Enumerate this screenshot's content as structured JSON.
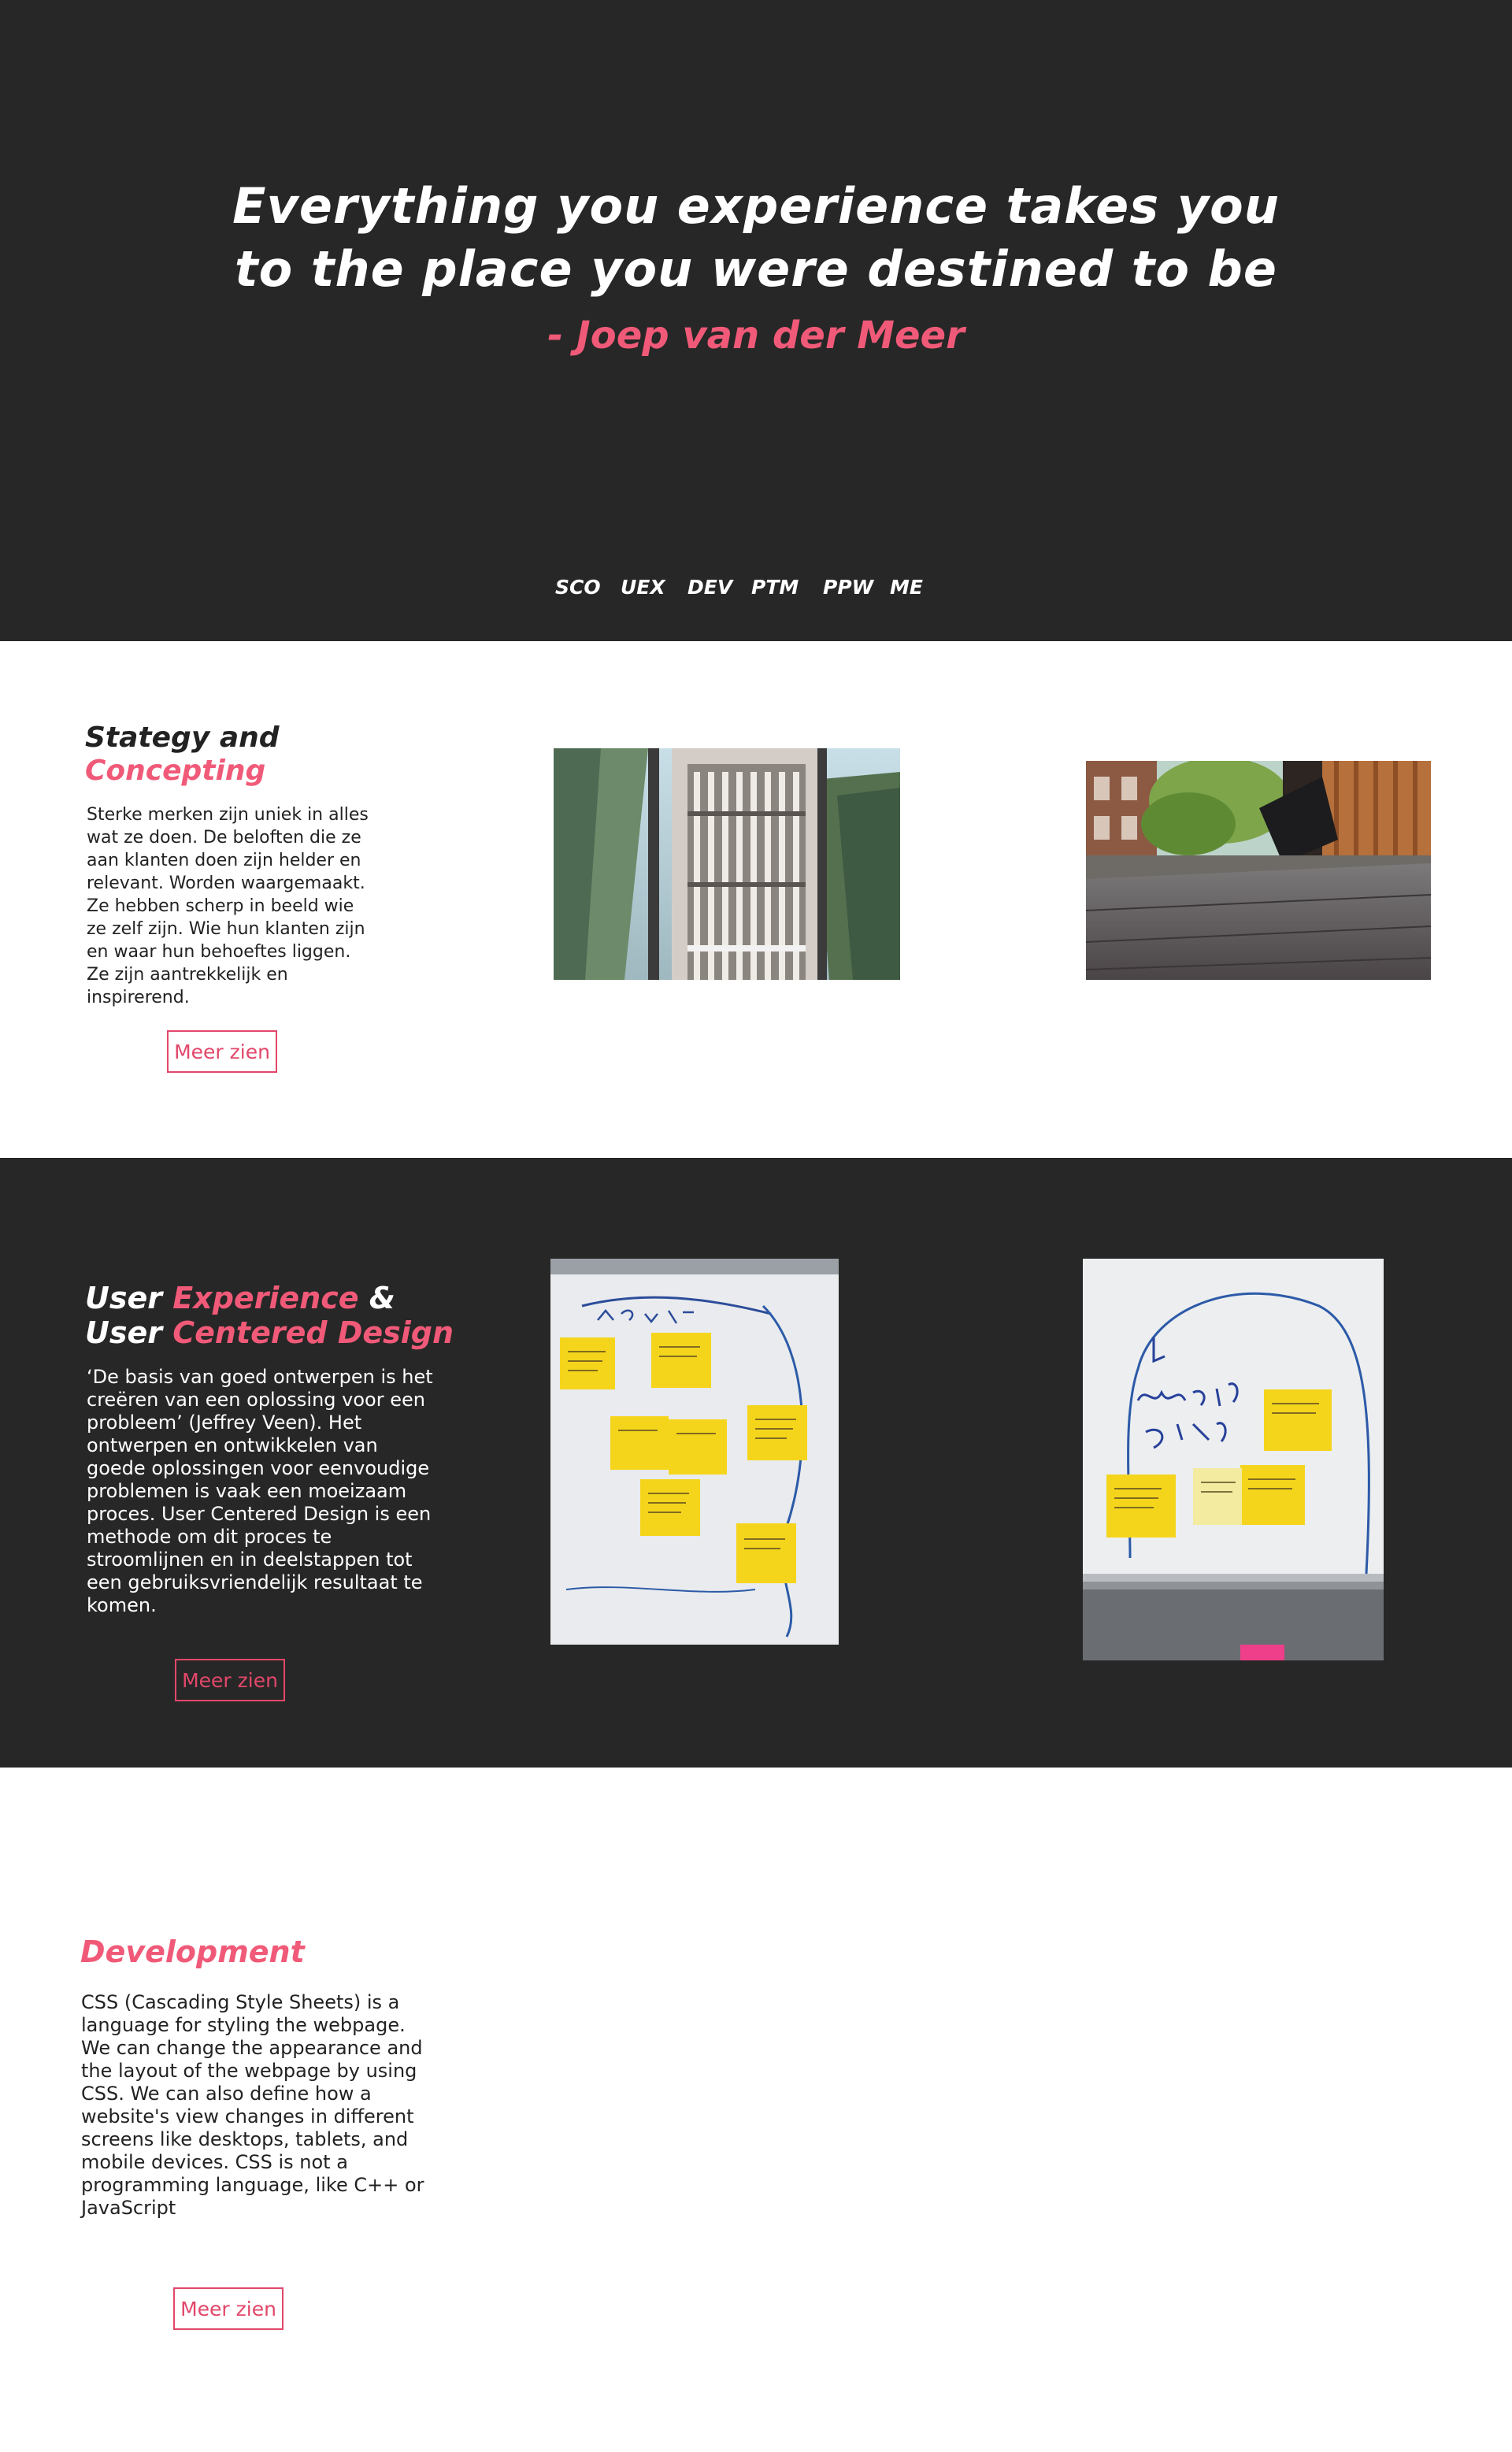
{
  "hero": {
    "quote_line1": "Everything you experience takes you",
    "quote_line2": "to the place you were destined to be",
    "author": "- Joep van der Meer",
    "nav": [
      "SCO",
      "UEX",
      "DEV",
      "PTM",
      "PPW",
      "ME"
    ]
  },
  "sco": {
    "title_part1": "Stategy and",
    "title_part2": "Concepting",
    "body": "Sterke merken zijn uniek in alles wat ze doen. De beloften die ze aan klanten doen zijn helder en relevant. Worden waargemaakt. Ze hebben scherp in beeld wie ze zelf zijn. Wie hun klanten zijn en waar hun behoeftes liggen. Ze zijn aantrekkelijk en inspirerend.",
    "button": "Meer zien"
  },
  "uex": {
    "title_a1": "User ",
    "title_a2": "Experience",
    "title_a3": " &",
    "title_b1": "User ",
    "title_b2": "Centered Design",
    "body": "‘De basis van goed ontwerpen is het creëren van een oplossing voor een probleem’ (Jeffrey Veen). Het ontwerpen en ontwikkelen van goede oplossingen voor eenvoudige problemen is vaak een moeizaam proces. User Centered Design is een methode om dit proces te stroomlijnen en in deelstappen tot een gebruiksvriendelijk resultaat te komen.",
    "button": "Meer zien"
  },
  "dev": {
    "title": "Development",
    "body": "CSS (Cascading Style Sheets) is a language for styling the webpage. We can change the appearance and the layout of the webpage by using CSS. We can also define how a website's view changes in different screens like desktops, tablets, and mobile devices. CSS is not a programming language, like C++ or JavaScript",
    "button": "Meer zien"
  },
  "colors": {
    "dark": "#272727",
    "accent": "#f05a78",
    "light": "#ffffff"
  }
}
